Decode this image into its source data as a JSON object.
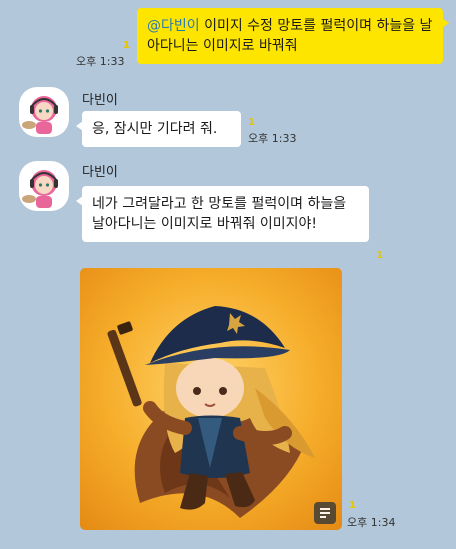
{
  "messages": {
    "outgoing": {
      "mention": "@다빈이",
      "text": " 이미지 수정 망토를 펄럭이며 하늘을 날아다니는 이미지로 바꿔줘",
      "unread": "1",
      "time": "오후 1:33"
    },
    "reply1": {
      "sender": "다빈이",
      "text": "응, 잠시만 기다려 줘.",
      "unread": "1",
      "time": "오후 1:33"
    },
    "reply2": {
      "sender": "다빈이",
      "text": "네가 그려달라고 한 망토를 펄럭이며 하늘을 날아다니는 이미지로 바꿔줘 이미지야!",
      "unread": "1"
    },
    "image": {
      "unread": "1",
      "time": "오후 1:34",
      "save_icon": "document-save-icon"
    }
  },
  "colors": {
    "background": "#b2c7d9",
    "my_bubble": "#fee500",
    "other_bubble": "#ffffff",
    "mention": "#2a7ab0"
  }
}
